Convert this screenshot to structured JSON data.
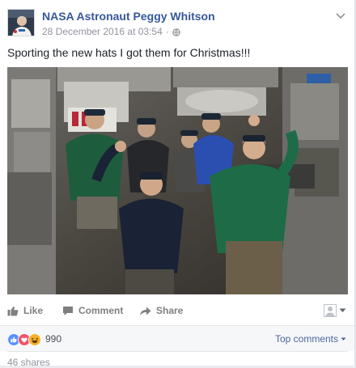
{
  "post": {
    "author": "NASA Astronaut Peggy Whitson",
    "timestamp": "28 December 2016 at 03:54",
    "text": "Sporting the new hats I got them for Christmas!!!",
    "photo_alt": "Astronauts floating in the space station wearing new caps"
  },
  "actions": {
    "like_label": "Like",
    "comment_label": "Comment",
    "share_label": "Share"
  },
  "reactions": {
    "count": "990",
    "types": [
      "like-icon",
      "love-icon",
      "haha-icon"
    ],
    "top_comments_label": "Top comments"
  },
  "shares": {
    "label": "46 shares"
  },
  "colors": {
    "link_blue": "#365899",
    "like_blue": "#5890ff",
    "love_red": "#f25268",
    "haha_yellow": "#f7b125",
    "muted": "#90949c"
  }
}
